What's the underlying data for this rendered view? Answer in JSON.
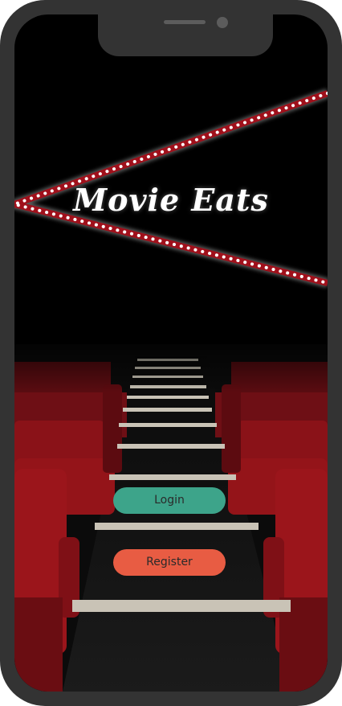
{
  "app": {
    "title": "Movie Eats"
  },
  "actions": {
    "login_label": "Login",
    "register_label": "Register"
  },
  "colors": {
    "login_button": "#3da48a",
    "register_button": "#e85c43",
    "marquee_red": "#a0101b",
    "marquee_bulb": "#ffffff",
    "seat_red": "#8a1218",
    "frame": "#333333"
  },
  "icons": {
    "marquee": "marquee-light-strip",
    "seats": "theater-seats"
  }
}
